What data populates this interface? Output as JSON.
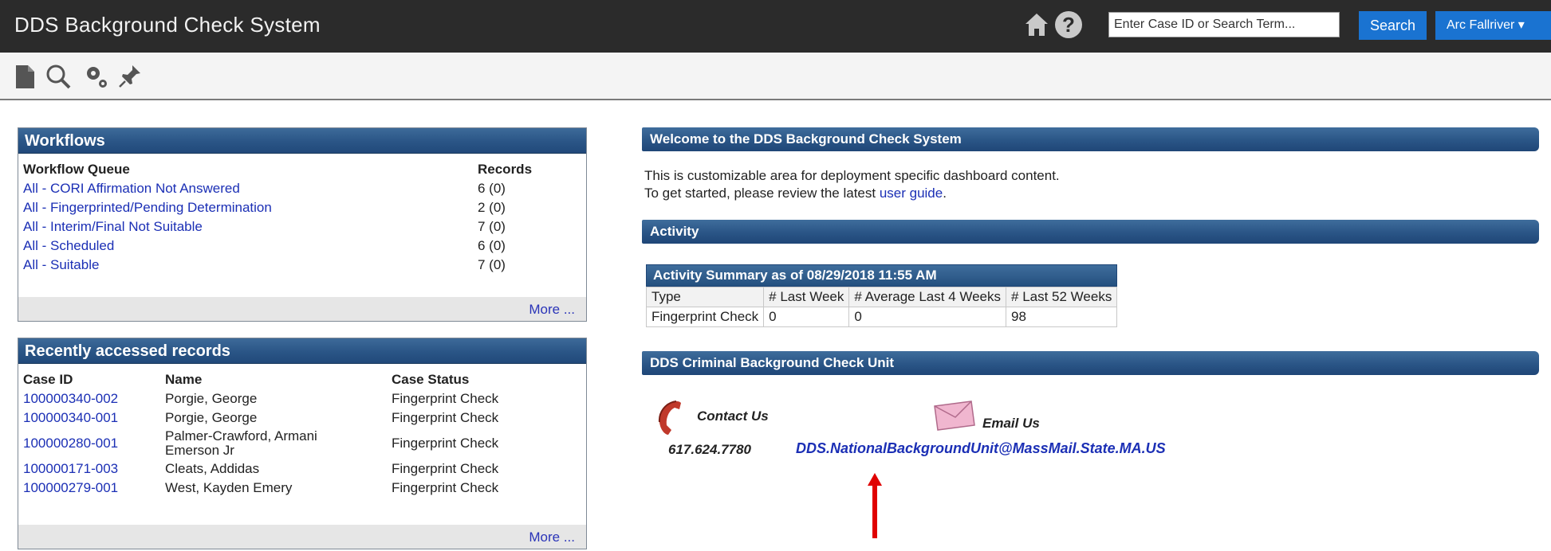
{
  "header": {
    "title": "DDS Background Check System",
    "search_placeholder": "Enter Case ID or Search Term...",
    "search_button": "Search",
    "user_menu": "Arc Fallriver ▾"
  },
  "toolbar": {
    "icons": [
      "new-document-icon",
      "search-icon",
      "settings-icon",
      "pin-icon"
    ]
  },
  "workflows": {
    "title": "Workflows",
    "col_queue": "Workflow Queue",
    "col_records": "Records",
    "rows": [
      {
        "queue": "All - CORI Affirmation Not Answered",
        "records": "6 (0)"
      },
      {
        "queue": "All - Fingerprinted/Pending Determination",
        "records": "2 (0)"
      },
      {
        "queue": "All - Interim/Final Not Suitable",
        "records": "7 (0)"
      },
      {
        "queue": "All - Scheduled",
        "records": "6 (0)"
      },
      {
        "queue": "All - Suitable",
        "records": "7 (0)"
      }
    ],
    "more": "More ..."
  },
  "recent": {
    "title": "Recently accessed records",
    "col_case": "Case ID",
    "col_name": "Name",
    "col_status": "Case Status",
    "rows": [
      {
        "case": "100000340-002",
        "name": "Porgie, George",
        "status": "Fingerprint Check"
      },
      {
        "case": "100000340-001",
        "name": "Porgie, George",
        "status": "Fingerprint Check"
      },
      {
        "case": "100000280-001",
        "name": "Palmer-Crawford, Armani Emerson Jr",
        "status": "Fingerprint Check"
      },
      {
        "case": "100000171-003",
        "name": "Cleats, Addidas",
        "status": "Fingerprint Check"
      },
      {
        "case": "100000279-001",
        "name": "West, Kayden Emery",
        "status": "Fingerprint Check"
      }
    ],
    "more": "More ..."
  },
  "welcome": {
    "title": "Welcome to the DDS Background Check System",
    "line1": "This is customizable area for deployment specific dashboard content.",
    "line2_prefix": "To get started, please review the latest ",
    "line2_link": "user guide",
    "line2_suffix": "."
  },
  "activity": {
    "title": "Activity",
    "summary_caption": "Activity Summary as of 08/29/2018 11:55 AM",
    "headers": [
      "Type",
      "# Last Week",
      "# Average Last 4 Weeks",
      "# Last 52 Weeks"
    ],
    "row": [
      "Fingerprint Check",
      "0",
      "0",
      "98"
    ]
  },
  "unit": {
    "title": "DDS Criminal Background Check Unit",
    "contact_label": "Contact Us",
    "phone": "617.624.7780",
    "email_label": "Email Us",
    "email": "DDS.NationalBackgroundUnit@MassMail.State.MA.US"
  },
  "colors": {
    "header_bg": "#2b2b2b",
    "accent_blue": "#1a73d1",
    "panel_header": "#2a5586",
    "link": "#1b2fb5",
    "annotation_arrow": "#e00000"
  }
}
